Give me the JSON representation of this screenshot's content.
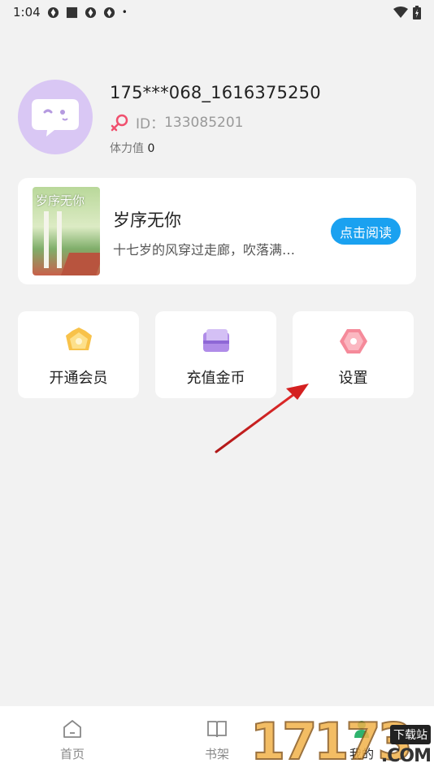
{
  "status_bar": {
    "time": "1:04",
    "dot": "•"
  },
  "profile": {
    "username": "175***068_1616375250",
    "id_label": "ID：",
    "id_value": "133085201",
    "stamina_label": "体力值",
    "stamina_value": "0"
  },
  "book": {
    "cover_title": "岁序无你",
    "title": "岁序无你",
    "description": "十七岁的风穿过走廊，吹落满…",
    "read_button": "点击阅读"
  },
  "grid": {
    "items": [
      {
        "label": "开通会员",
        "icon": "crown-icon"
      },
      {
        "label": "充值金币",
        "icon": "card-icon"
      },
      {
        "label": "设置",
        "icon": "settings-icon"
      }
    ]
  },
  "tabbar": {
    "items": [
      {
        "label": "首页",
        "icon": "home-icon"
      },
      {
        "label": "书架",
        "icon": "book-icon"
      },
      {
        "label": "我的",
        "icon": "profile-icon"
      }
    ]
  },
  "watermark": {
    "digits": "17173",
    "top": "下载站",
    "com": ".COM"
  },
  "colors": {
    "accent": "#1aa1f0",
    "avatar_bg": "#d9c7f4",
    "background": "#f2f2f2",
    "arrow": "#d42020",
    "gender_icon": "#f0506e"
  }
}
